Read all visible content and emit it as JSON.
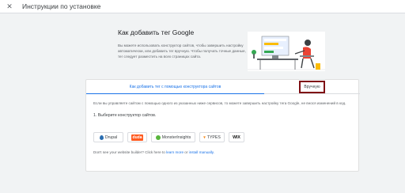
{
  "topbar": {
    "close_icon": "close-icon",
    "title": "Инструкции по установке"
  },
  "hero": {
    "title": "Как добавить тег Google",
    "description": "Вы можете использовать конструктор сайтов, чтобы завершить настройку автоматически, или добавить тег вручную. Чтобы получать точные данные, тег следует разместить на всех страницах сайта."
  },
  "tabs": {
    "cms": "Как добавить тег с помощью конструктора сайтов",
    "manual": "Вручную"
  },
  "body": {
    "intro": "Если вы управляете сайтом с помощью одного из указанных ниже сервисов, то можете завершить настройку тега Google, не внося изменений в код.",
    "step": "1. Выберите конструктор сайтов."
  },
  "builders": [
    "Drupal",
    "duda",
    "MonsterInsights",
    "TYPES",
    "WIX"
  ],
  "footer": {
    "prefix": "Don't see your website builder? Click here to",
    "learn_more": "learn more",
    "or": "or",
    "install_manually": "install manually."
  },
  "colors": {
    "accent": "#1a73e8",
    "highlight_border": "#7f0f14"
  }
}
